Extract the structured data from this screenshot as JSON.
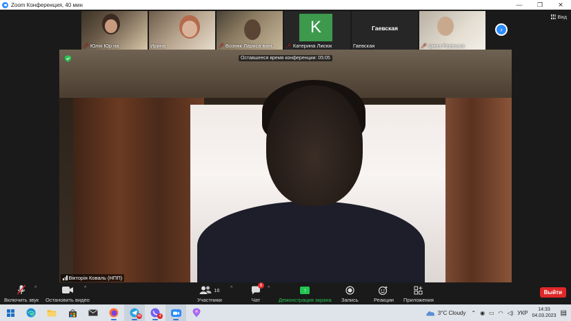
{
  "window": {
    "title": "Zoom Конференция, 40 мин",
    "controls": [
      "—",
      "❐",
      "✕"
    ]
  },
  "view_button": {
    "label": "Вид"
  },
  "participants_strip": [
    {
      "name": "Юлія Юр на",
      "muted": true,
      "kind": "video"
    },
    {
      "name": "Ирина",
      "muted": false,
      "kind": "video"
    },
    {
      "name": "Возняк Лариса  вані...",
      "muted": true,
      "kind": "video"
    },
    {
      "name": "Катерина Лисюк",
      "muted": true,
      "kind": "avatar",
      "initial": "K"
    },
    {
      "name": "Гаевская",
      "muted": false,
      "kind": "name",
      "display_name": "Гаевская"
    },
    {
      "name": "Ірина Раєвська",
      "muted": true,
      "kind": "video"
    }
  ],
  "main_video": {
    "speaker_name": "Вікторія Коваль (НПП)",
    "timer_text": "Оставшееся время конференции: 05:05"
  },
  "toolbar": {
    "unmute_label": "Включить звук",
    "stop_video_label": "Остановить видео",
    "participants_label": "Участники",
    "participants_count": "16",
    "chat_label": "Чат",
    "chat_badge": "8",
    "share_label": "Демонстрация экрана",
    "record_label": "Запись",
    "reactions_label": "Реакции",
    "apps_label": "Приложения",
    "leave_label": "Выйти"
  },
  "taskbar": {
    "weather_text": "3°C  Cloudy",
    "language": "УКР",
    "time": "14:33",
    "date": "04.03.2023",
    "telegram_badge": "45",
    "viber_badge": "4"
  },
  "colors": {
    "zoom_blue": "#2d8cff",
    "share_green": "#23c552",
    "leave_red": "#e02828",
    "avatar_green": "#3d9a4d"
  }
}
